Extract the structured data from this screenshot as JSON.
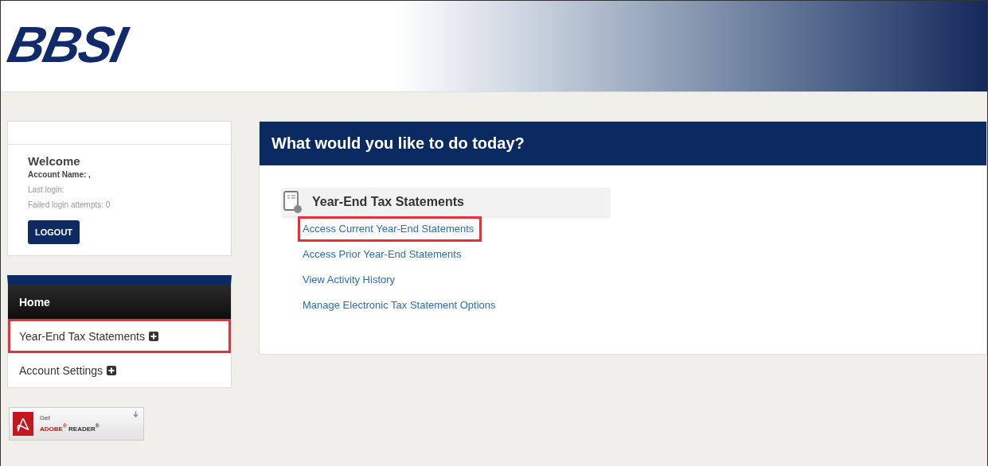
{
  "header": {
    "logo": "BBSI"
  },
  "welcome": {
    "title": "Welcome",
    "account_label": "Account Name: ,",
    "last_login": "Last login:",
    "failed_attempts": "Failed login attempts: 0",
    "logout_button": "LOGOUT"
  },
  "sidebar": {
    "items": [
      {
        "label": "Home",
        "selected": true,
        "expandable": false,
        "highlighted": false
      },
      {
        "label": "Year-End Tax Statements",
        "selected": false,
        "expandable": true,
        "highlighted": true
      },
      {
        "label": "Account Settings",
        "selected": false,
        "expandable": true,
        "highlighted": false
      }
    ]
  },
  "adobe_badge": {
    "get": "Get",
    "brand": "ADOBE$^{®}$",
    "product": "READER$^{®}$"
  },
  "main": {
    "title": "What would you like to do today?",
    "section": {
      "title": "Year-End Tax Statements",
      "links": [
        {
          "label": "Access Current Year-End Statements",
          "highlighted": true
        },
        {
          "label": "Access Prior Year-End Statements",
          "highlighted": false
        },
        {
          "label": "View Activity History",
          "highlighted": false
        },
        {
          "label": "Manage Electronic Tax Statement Options",
          "highlighted": false
        }
      ]
    }
  }
}
